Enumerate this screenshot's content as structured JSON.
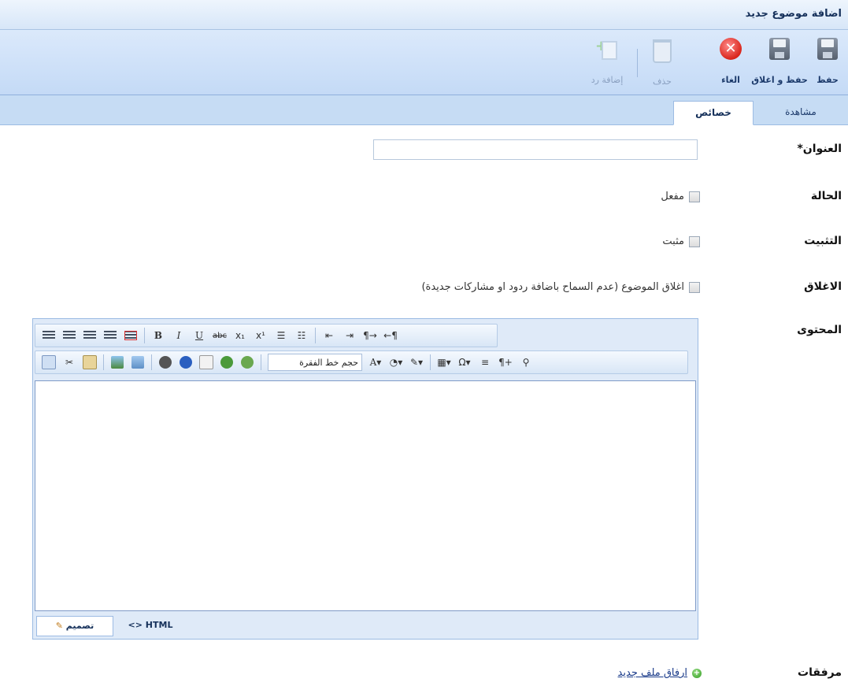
{
  "window": {
    "title": "اضافة موضوع جديد"
  },
  "ribbon": {
    "buttons": [
      {
        "label": "حفظ",
        "icon": "save-icon",
        "enabled": true
      },
      {
        "label": "حفظ و اغلاق",
        "icon": "save-close-icon",
        "enabled": true
      },
      {
        "label": "الغاء",
        "icon": "cancel-icon",
        "enabled": true
      },
      {
        "label": "حذف",
        "icon": "trash-icon",
        "enabled": false
      },
      {
        "label": "إضافة رد",
        "icon": "add-reply-icon",
        "enabled": false
      }
    ]
  },
  "tabs": [
    {
      "label": "مشاهدة",
      "active": false
    },
    {
      "label": "خصائص",
      "active": true
    }
  ],
  "form": {
    "title_label": "العنوان*",
    "title_value": "",
    "status_label": "الحالة",
    "status_option": "مفعل",
    "pin_label": "التثبيت",
    "pin_option": "مثبت",
    "lock_label": "الاغلاق",
    "lock_option": "اغلاق الموضوع (عدم السماح باضافة ردود او مشاركات جديدة)",
    "content_label": "المحتوى",
    "attachments_label": "مرفقات",
    "attach_link": "ارفاق ملف جديد"
  },
  "editor": {
    "paragraph_dropdown": "حجم خط الفقرة",
    "mode_design": "تصميم",
    "mode_html": "HTML",
    "active_mode": "design"
  },
  "colors": {
    "accent": "#c6dcf4",
    "header_text": "#15305a"
  }
}
